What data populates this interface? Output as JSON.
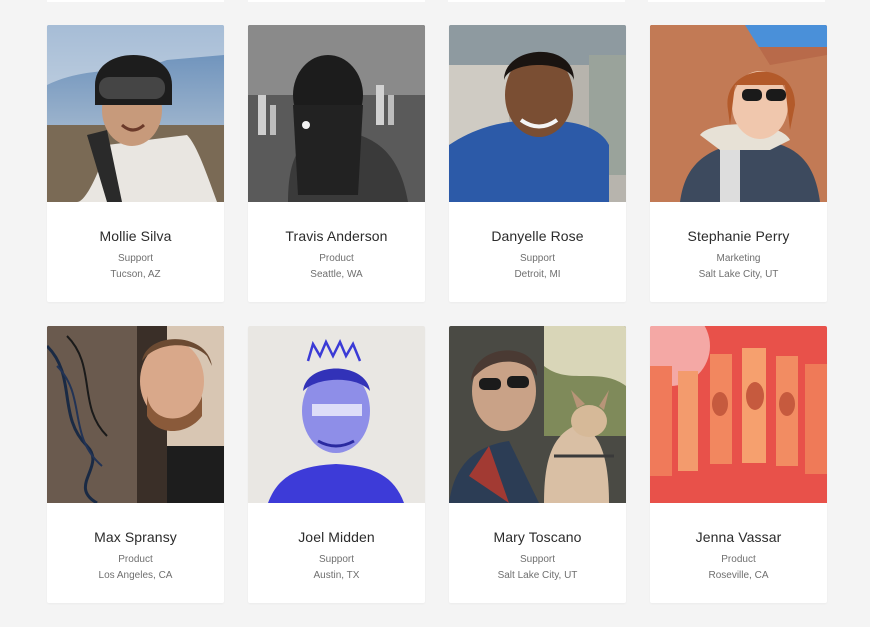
{
  "people": [
    {
      "name": "Mollie Silva",
      "role": "Support",
      "location": "Tucson, AZ"
    },
    {
      "name": "Travis Anderson",
      "role": "Product",
      "location": "Seattle, WA"
    },
    {
      "name": "Danyelle Rose",
      "role": "Support",
      "location": "Detroit, MI"
    },
    {
      "name": "Stephanie Perry",
      "role": "Marketing",
      "location": "Salt Lake City, UT"
    },
    {
      "name": "Max Spransy",
      "role": "Product",
      "location": "Los Angeles, CA"
    },
    {
      "name": "Joel Midden",
      "role": "Support",
      "location": "Austin, TX"
    },
    {
      "name": "Mary Toscano",
      "role": "Support",
      "location": "Salt Lake City, UT"
    },
    {
      "name": "Jenna Vassar",
      "role": "Product",
      "location": "Roseville, CA"
    }
  ],
  "colors": {
    "background": "#f4f4f4",
    "card": "#ffffff",
    "name_text": "#2b2b2b",
    "meta_text": "#6f6f6f"
  }
}
